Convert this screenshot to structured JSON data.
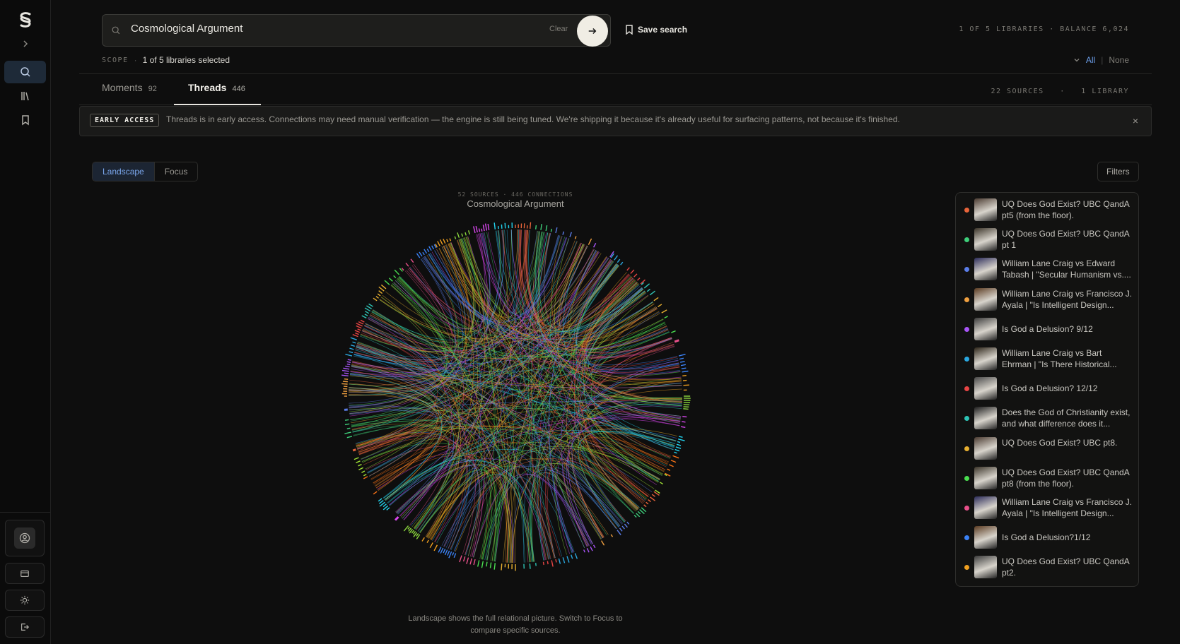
{
  "sidebar": {
    "items": [
      {
        "name": "expand",
        "icon": "chevron-right-icon"
      },
      {
        "name": "search",
        "icon": "search-icon",
        "active": true
      },
      {
        "name": "library",
        "icon": "library-icon"
      },
      {
        "name": "bookmarks",
        "icon": "bookmark-icon"
      }
    ],
    "bottom": [
      "user-icon",
      "card-icon",
      "sun-icon",
      "logout-icon"
    ]
  },
  "search": {
    "value": "Cosmological Argument",
    "clear_label": "Clear",
    "save_label": "Save search"
  },
  "top_meta": "1 OF 5 LIBRARIES · BALANCE 6,024",
  "scope": {
    "label": "SCOPE",
    "value": "1 of 5 libraries selected",
    "all": "All",
    "none": "None"
  },
  "tabs": [
    {
      "label": "Moments",
      "count": "92",
      "active": false
    },
    {
      "label": "Threads",
      "count": "446",
      "active": true
    }
  ],
  "sources_meta": "22 SOURCES   ·   1 LIBRARY",
  "banner": {
    "badge": "EARLY ACCESS",
    "text": "Threads is in early access. Connections may need manual verification — the engine is still being tuned. We're shipping it because it's already useful for surfacing patterns, not because it's finished.",
    "close": "×"
  },
  "view": {
    "landscape": "Landscape",
    "focus": "Focus",
    "filters": "Filters"
  },
  "chord": {
    "meta": "52 SOURCES · 446 CONNECTIONS",
    "title": "Cosmological Argument",
    "caption": "Landscape shows the full relational picture. Switch to Focus to compare specific sources."
  },
  "sources": [
    {
      "title": "UQ Does God Exist? UBC QandA pt5 (from the floor).",
      "color": "#e8643a"
    },
    {
      "title": "UQ Does God Exist? UBC QandA pt 1",
      "color": "#3ecf7a"
    },
    {
      "title": "William Lane Craig vs Edward Tabash | \"Secular Humanism vs....",
      "color": "#5b7de8"
    },
    {
      "title": "William Lane Craig vs Francisco J. Ayala | \"Is Intelligent Design...",
      "color": "#f0a040"
    },
    {
      "title": "Is God a Delusion? 9/12",
      "color": "#a855f7"
    },
    {
      "title": "William Lane Craig vs Bart Ehrman | \"Is There Historical...",
      "color": "#2aa8e0"
    },
    {
      "title": "Is God a Delusion? 12/12",
      "color": "#e84545"
    },
    {
      "title": "Does the God of Christianity exist, and what difference does it...",
      "color": "#2ec4b6"
    },
    {
      "title": "UQ Does God Exist? UBC pt8.",
      "color": "#e8b030"
    },
    {
      "title": "UQ Does God Exist? UBC QandA pt8 (from the floor).",
      "color": "#4ade50"
    },
    {
      "title": "William Lane Craig vs Francisco J. Ayala | \"Is Intelligent Design...",
      "color": "#e8508a"
    },
    {
      "title": "Is God a Delusion?1/12",
      "color": "#3b82f6"
    },
    {
      "title": "UQ Does God Exist? UBC QandA pt2.",
      "color": "#f0a020"
    }
  ],
  "palette": [
    "#e8643a",
    "#3ecf7a",
    "#5b7de8",
    "#f0a040",
    "#a855f7",
    "#2aa8e0",
    "#e84545",
    "#2ec4b6",
    "#e8b030",
    "#4ade50",
    "#e8508a",
    "#3b82f6",
    "#f0a020",
    "#8bd63e",
    "#d946ef",
    "#22d3ee",
    "#f97316",
    "#a3e635"
  ]
}
